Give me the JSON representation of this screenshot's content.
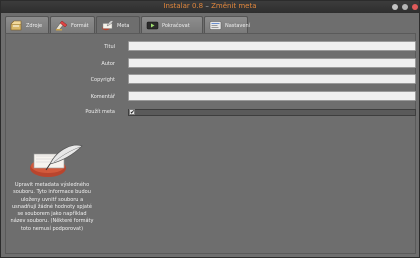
{
  "window": {
    "app_name": "Instalar 0.8",
    "separator": "–",
    "subtitle": "Změnit meta"
  },
  "tabs": [
    {
      "label": "Zdroje",
      "icon": "source-icon"
    },
    {
      "label": "Formát",
      "icon": "format-icon"
    },
    {
      "label": "Meta",
      "icon": "meta-icon",
      "active": true
    },
    {
      "label": "Pokračovat",
      "icon": "continue-icon"
    },
    {
      "label": "Nastavení",
      "icon": "settings-icon"
    }
  ],
  "description": "Upravit metadata výsledného souboru. Tyto informace budou uloženy uvnitř souboru a usnadňují žádné hodnoty spjaté se souborem jako například název souboru. (Některé formáty toto nemusí podporovat)",
  "fields": [
    {
      "label": "Titul",
      "value": ""
    },
    {
      "label": "Autor",
      "value": ""
    },
    {
      "label": "Copyright",
      "value": ""
    },
    {
      "label": "Komentář",
      "value": ""
    }
  ],
  "use_meta": {
    "label": "Použít meta",
    "checked": true,
    "check_glyph": "✔"
  }
}
